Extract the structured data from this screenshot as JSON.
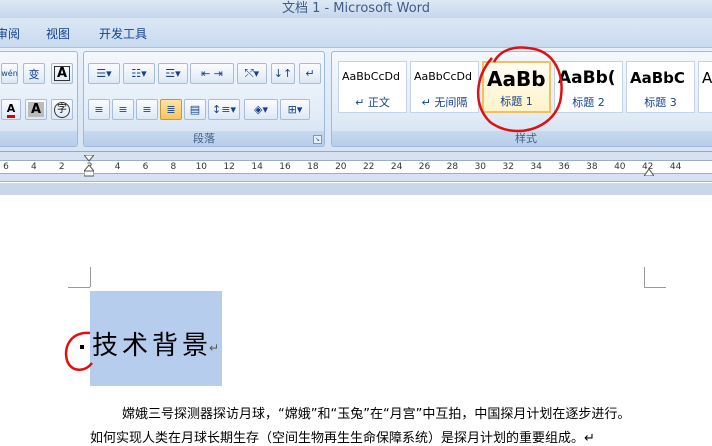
{
  "window": {
    "title": "文档 1 - Microsoft Word"
  },
  "tabs": [
    "审阅",
    "视图",
    "开发工具"
  ],
  "ribbon": {
    "groups": {
      "paragraph": "段落",
      "styles": "样式"
    },
    "font_icons": {
      "phonetic": "wén",
      "wen": "变",
      "boxed_a": "A",
      "shaded_a": "A",
      "enclosed": "字",
      "font_color": "A"
    },
    "styles": [
      {
        "sample": "AaBbCcDd",
        "name": "↵ 正文"
      },
      {
        "sample": "AaBbCcDd",
        "name": "↵ 无间隔"
      },
      {
        "sample": "AaBb",
        "name": "标题 1"
      },
      {
        "sample": "AaBb(",
        "name": "标题 2"
      },
      {
        "sample": "AaBbC",
        "name": "标题 3"
      },
      {
        "sample": "A",
        "name": ""
      }
    ]
  },
  "ruler": {
    "ticks": [
      "6",
      "4",
      "2",
      "2",
      "4",
      "6",
      "8",
      "10",
      "12",
      "14",
      "16",
      "18",
      "20",
      "22",
      "24",
      "26",
      "28",
      "30",
      "32",
      "34",
      "36",
      "38",
      "40",
      "42",
      "44"
    ]
  },
  "document": {
    "heading": "技术背景",
    "heading_mark": "↵",
    "para1": "嫦娥三号探测器探访月球，“嫦娥”和“玉兔”在“月宫”中互拍，中国探月计划在逐步进行。",
    "para2": "如何实现人类在月球长期生存（空间生物再生生命保障系统）是探月计划的重要组成。↵"
  },
  "colors": {
    "accent": "#15428b",
    "highlight": "#b7cdee",
    "annotation": "#e01010"
  }
}
